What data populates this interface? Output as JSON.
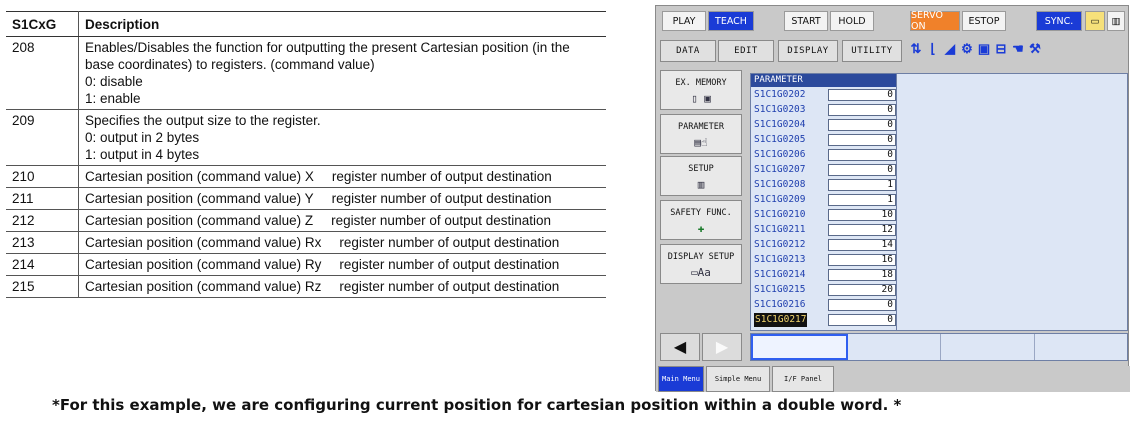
{
  "table": {
    "headers": [
      "S1CxG",
      "Description"
    ],
    "rows": [
      {
        "id": "208",
        "lines": [
          "Enables/Disables the function for outputting the present Cartesian position (in the",
          "base coordinates) to registers.  (command value)",
          "0: disable",
          "1: enable"
        ]
      },
      {
        "id": "209",
        "lines": [
          "Specifies the output size to the register.",
          "0: output in 2 bytes",
          "1: output in 4 bytes"
        ]
      },
      {
        "id": "210",
        "desc": "Cartesian position (command value) X",
        "dest": "register number of output destination"
      },
      {
        "id": "211",
        "desc": "Cartesian position (command value) Y",
        "dest": "register number of output destination"
      },
      {
        "id": "212",
        "desc": "Cartesian position (command value) Z",
        "dest": "register number of output destination"
      },
      {
        "id": "213",
        "desc": "Cartesian position (command value) Rx",
        "dest": "register number of output destination"
      },
      {
        "id": "214",
        "desc": "Cartesian position (command value) Ry",
        "dest": "register number of output destination"
      },
      {
        "id": "215",
        "desc": "Cartesian position (command value) Rz",
        "dest": "register number of output destination"
      }
    ]
  },
  "pendant": {
    "toolbar": [
      "PLAY",
      "TEACH",
      "START",
      "HOLD",
      "SERVO ON",
      "ESTOP",
      "SYNC."
    ],
    "menu": [
      "DATA",
      "EDIT",
      "DISPLAY",
      "UTILITY"
    ],
    "side_buttons": [
      "EX. MEMORY",
      "PARAMETER",
      "SETUP",
      "SAFETY FUNC.",
      "DISPLAY SETUP"
    ],
    "panel_title": "PARAMETER",
    "params": [
      {
        "name": "S1C1G0202",
        "value": "0"
      },
      {
        "name": "S1C1G0203",
        "value": "0"
      },
      {
        "name": "S1C1G0204",
        "value": "0"
      },
      {
        "name": "S1C1G0205",
        "value": "0"
      },
      {
        "name": "S1C1G0206",
        "value": "0"
      },
      {
        "name": "S1C1G0207",
        "value": "0"
      },
      {
        "name": "S1C1G0208",
        "value": "1"
      },
      {
        "name": "S1C1G0209",
        "value": "1"
      },
      {
        "name": "S1C1G0210",
        "value": "10"
      },
      {
        "name": "S1C1G0211",
        "value": "12"
      },
      {
        "name": "S1C1G0212",
        "value": "14"
      },
      {
        "name": "S1C1G0213",
        "value": "16"
      },
      {
        "name": "S1C1G0214",
        "value": "18"
      },
      {
        "name": "S1C1G0215",
        "value": "20"
      },
      {
        "name": "S1C1G0216",
        "value": "0"
      },
      {
        "name": "S1C1G0217",
        "value": "0"
      }
    ],
    "footer_tabs": [
      "Main Menu",
      "Simple Menu",
      "I/F Panel"
    ]
  },
  "note": "*For this example, we are configuring current position for cartesian position within a double word. *"
}
